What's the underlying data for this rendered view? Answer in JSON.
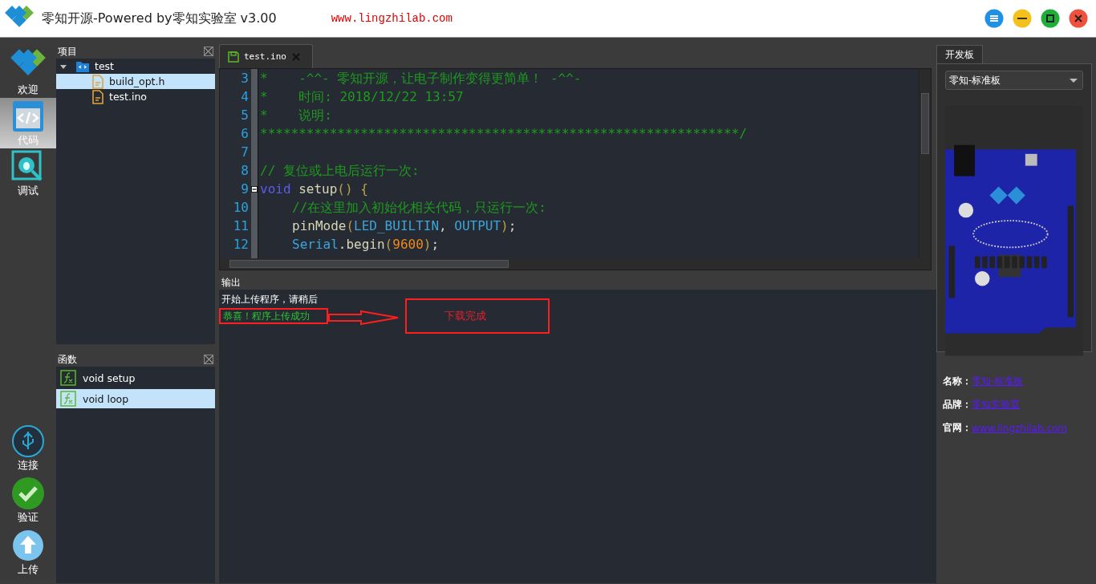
{
  "window": {
    "title": "零知开源-Powered by零知实验室 v3.00",
    "url": "www.lingzhilab.com"
  },
  "window_buttons": [
    {
      "kind": "menu"
    },
    {
      "kind": "minimize"
    },
    {
      "kind": "maximize"
    },
    {
      "kind": "close"
    }
  ],
  "nav": {
    "top": [
      {
        "label": "欢迎",
        "kind": "logo",
        "selected": false
      },
      {
        "label": "代码",
        "kind": "code",
        "selected": true
      },
      {
        "label": "调试",
        "kind": "debug",
        "selected": false
      }
    ],
    "bottom": [
      {
        "label": "连接",
        "kind": "usb"
      },
      {
        "label": "验证",
        "kind": "verify"
      },
      {
        "label": "上传",
        "kind": "upload"
      }
    ]
  },
  "project_panel": {
    "title": "项目",
    "tree": [
      {
        "label": "test",
        "kind": "folder",
        "expanded": true,
        "selected": false,
        "children": [
          {
            "label": "build_opt.h",
            "kind": "file",
            "selected": true
          },
          {
            "label": "test.ino",
            "kind": "file",
            "selected": false
          }
        ]
      }
    ]
  },
  "functions_panel": {
    "title": "函数",
    "items": [
      {
        "label": "void setup",
        "selected": false
      },
      {
        "label": "void loop",
        "selected": true
      }
    ]
  },
  "editor": {
    "tabs": [
      {
        "label": "test.ino",
        "selected": true
      }
    ],
    "lines": [
      {
        "number": "3",
        "tokens": [
          {
            "text": "*    -^^- 零知开源，让电子制作变得更简单！ -^^-",
            "kind": "comment"
          }
        ]
      },
      {
        "number": "4",
        "tokens": [
          {
            "text": "*    时间: 2018/12/22 13:57",
            "kind": "comment"
          }
        ]
      },
      {
        "number": "5",
        "tokens": [
          {
            "text": "*    说明:",
            "kind": "comment"
          }
        ]
      },
      {
        "number": "6",
        "tokens": [
          {
            "text": "**************************************************************/",
            "kind": "comment"
          }
        ]
      },
      {
        "number": "7"
      },
      {
        "number": "8",
        "tokens": [
          {
            "text": "// 复位或上电后运行一次:",
            "kind": "comment"
          }
        ]
      },
      {
        "number": "9",
        "fold": true,
        "tokens": [
          {
            "text": "void",
            "kind": "keyword"
          },
          {
            "text": "setup",
            "kind": "function",
            "spaced": true
          },
          {
            "text": "()",
            "kind": "paren"
          },
          {
            "text": "{",
            "kind": "paren",
            "spaced": true
          }
        ]
      },
      {
        "number": "10",
        "indented": true,
        "tokens": [
          {
            "text": "//在这里加入初始化相关代码，只运行一次:",
            "kind": "comment"
          }
        ]
      },
      {
        "number": "11",
        "indented": true,
        "tokens": [
          {
            "text": "pinMode",
            "kind": "function"
          },
          {
            "text": "(",
            "kind": "paren"
          },
          {
            "text": "LED_BUILTIN",
            "kind": "constant"
          },
          {
            "text": ",",
            "kind": "plain"
          },
          {
            "text": "OUTPUT",
            "kind": "constant",
            "spaced": true
          },
          {
            "text": ")",
            "kind": "paren"
          },
          {
            "text": ";",
            "kind": "plain"
          }
        ]
      },
      {
        "number": "12",
        "indented": true,
        "tokens": [
          {
            "text": "Serial",
            "kind": "constant"
          },
          {
            "text": ".",
            "kind": "plain"
          },
          {
            "text": "begin",
            "kind": "function"
          },
          {
            "text": "(",
            "kind": "paren"
          },
          {
            "text": "9600",
            "kind": "number"
          },
          {
            "text": ")",
            "kind": "paren"
          },
          {
            "text": ";",
            "kind": "plain"
          }
        ]
      }
    ]
  },
  "output": {
    "title": "输出",
    "lines": [
      {
        "text": "开始上传程序，请稍后",
        "kind": "info"
      },
      {
        "text": "恭喜！程序上传成功",
        "kind": "success"
      }
    ],
    "annotation": {
      "text": "下载完成"
    }
  },
  "board_panel": {
    "tabs": [
      {
        "label": "开发板",
        "selected": true
      }
    ],
    "board_select": {
      "value": "零知-标准板"
    },
    "info": [
      {
        "label": "名称：",
        "value": "零知-标准板"
      },
      {
        "label": "品牌：",
        "value": "零知实验室"
      },
      {
        "label": "官网：",
        "value": "www.lingzhilab.com"
      }
    ]
  }
}
